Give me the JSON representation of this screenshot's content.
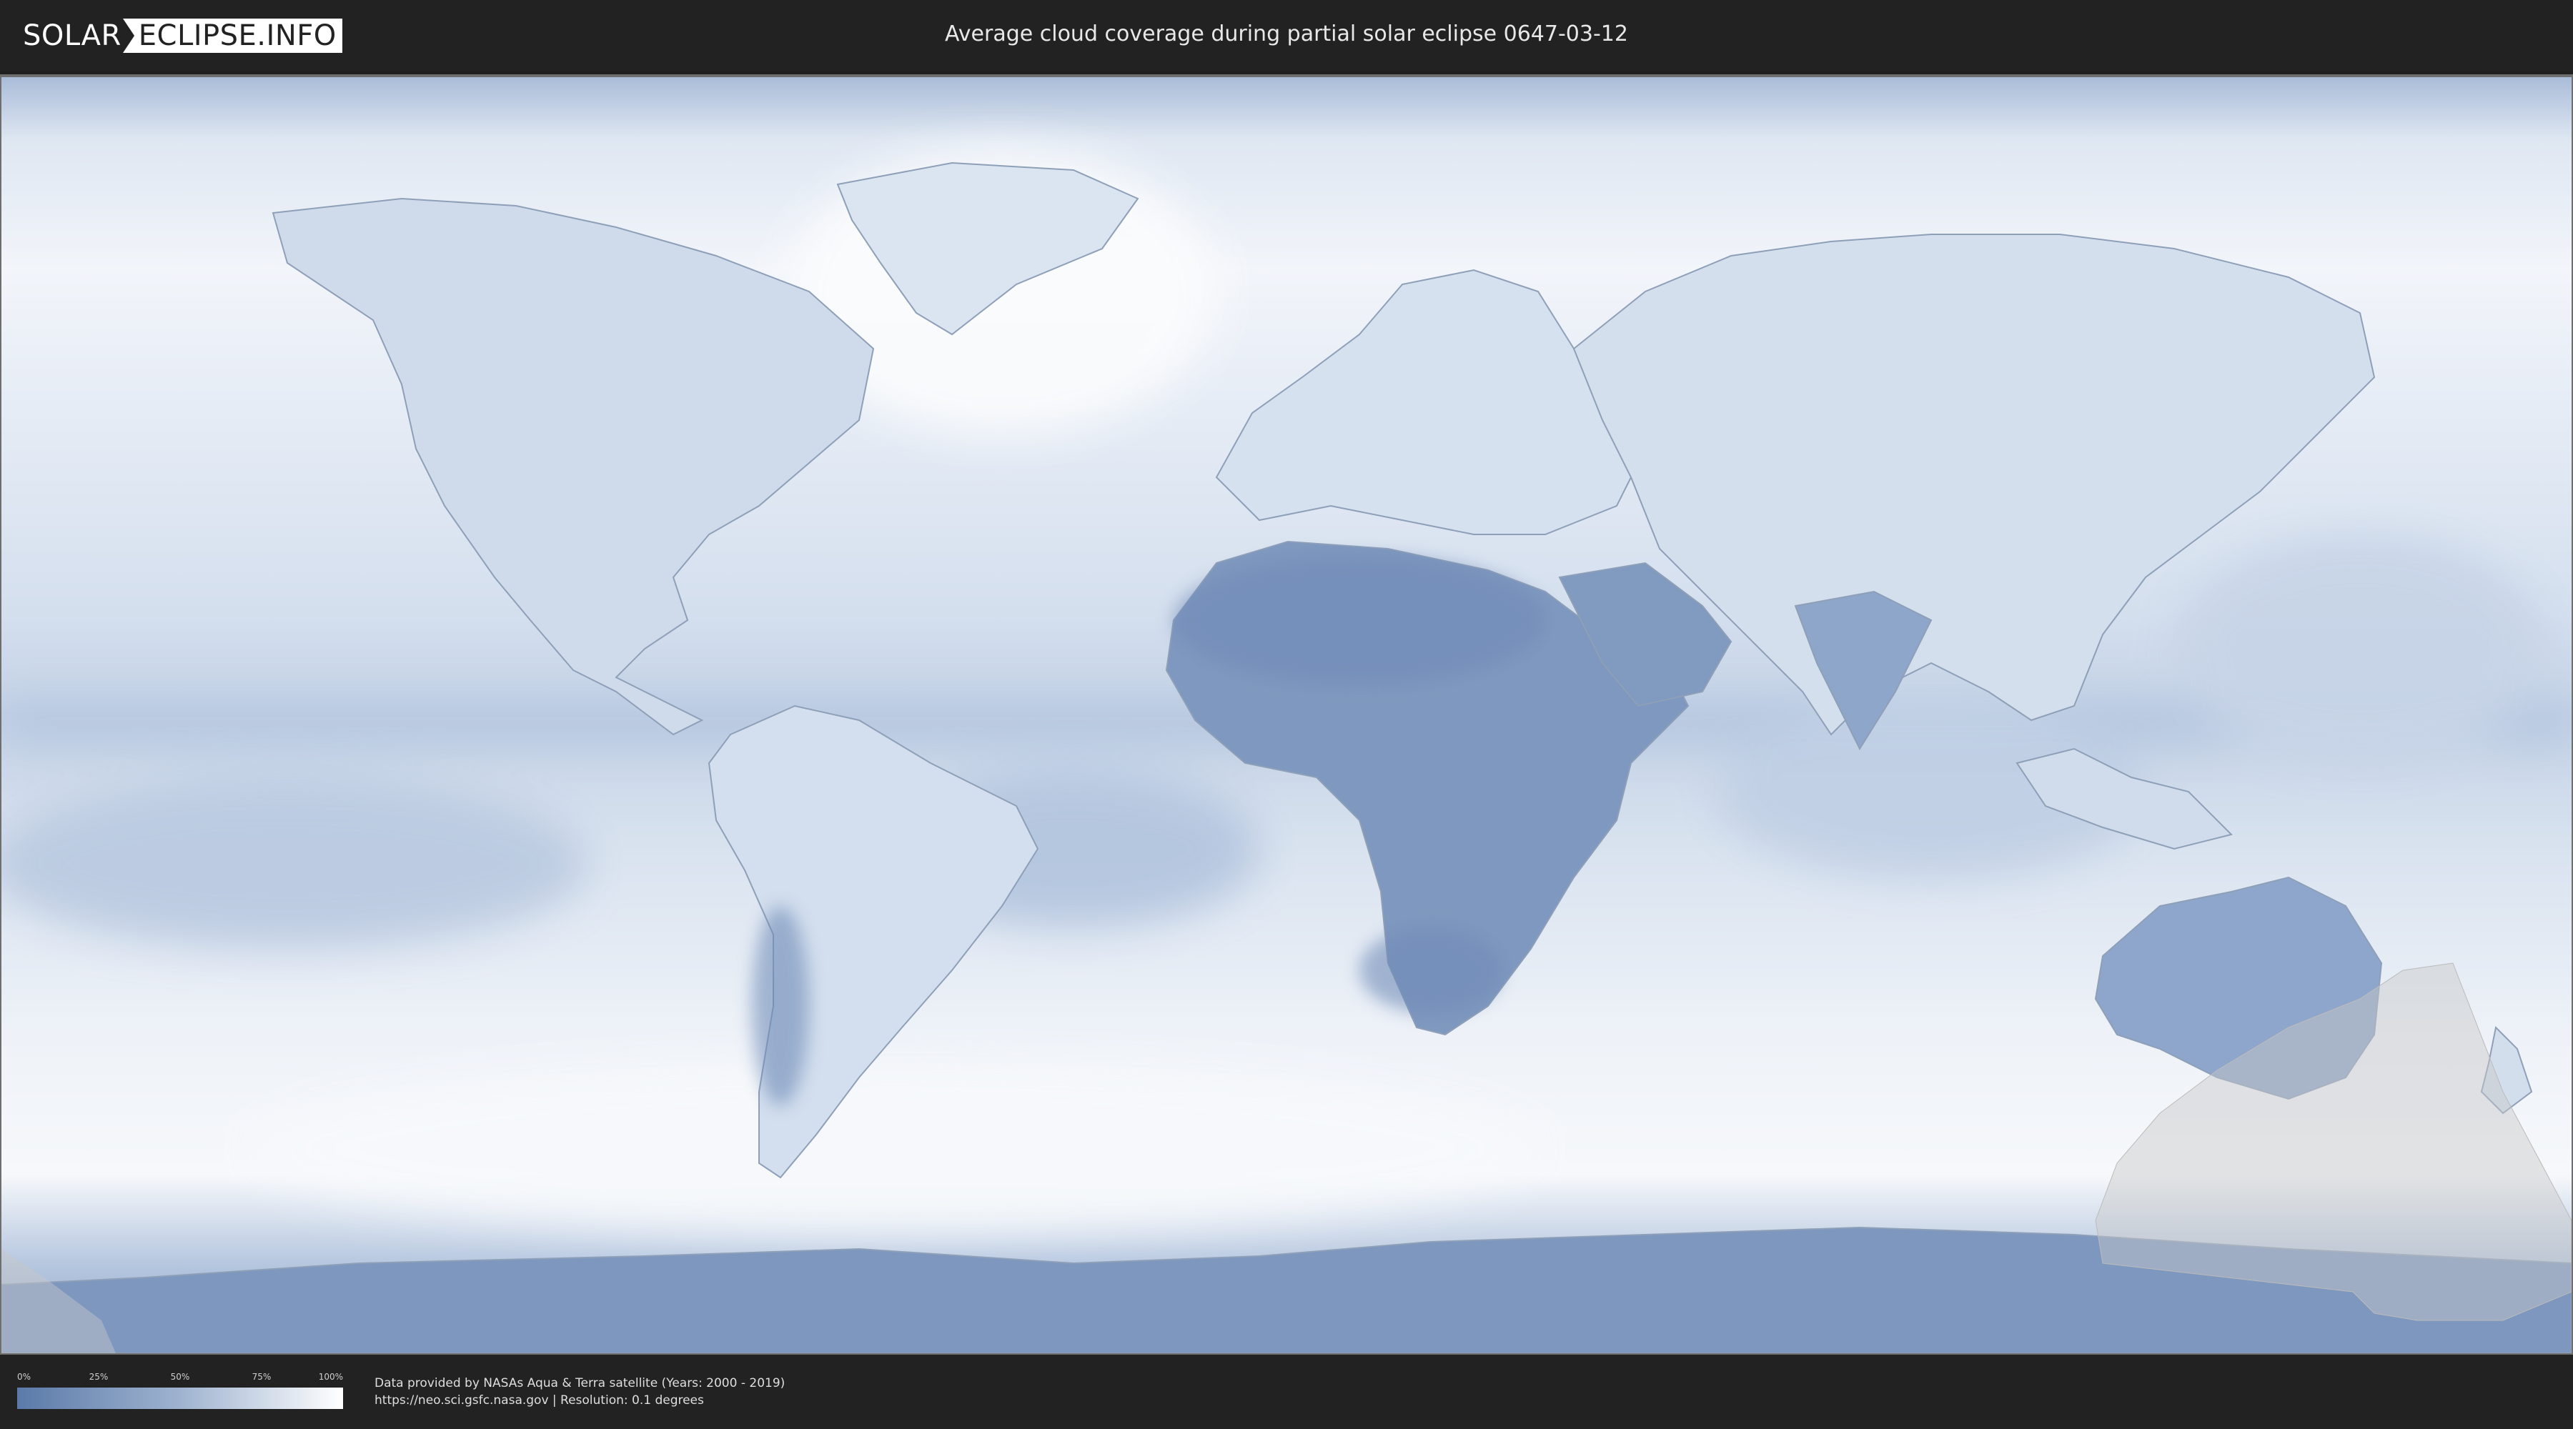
{
  "header": {
    "logo_solar": "SOLAR",
    "logo_rest": "ECLIPSE.INFO",
    "title": "Average cloud coverage during partial solar eclipse 0647-03-12"
  },
  "map": {
    "background_colors": {
      "cloudy": "#ffffff",
      "clear": "#5b7aa9",
      "mid": "#c9d6e8"
    },
    "eclipse_visibility_shade": "#c8c8c8"
  },
  "legend": {
    "ticks": [
      "0%",
      "25%",
      "50%",
      "75%",
      "100%"
    ],
    "gradient": {
      "from": "#5b7aa9",
      "to": "#ffffff"
    }
  },
  "footer": {
    "credit_line1": "Data provided by NASAs Aqua & Terra satellite (Years: 2000 - 2019)",
    "credit_line2": "https://neo.sci.gsfc.nasa.gov | Resolution: 0.1 degrees"
  }
}
